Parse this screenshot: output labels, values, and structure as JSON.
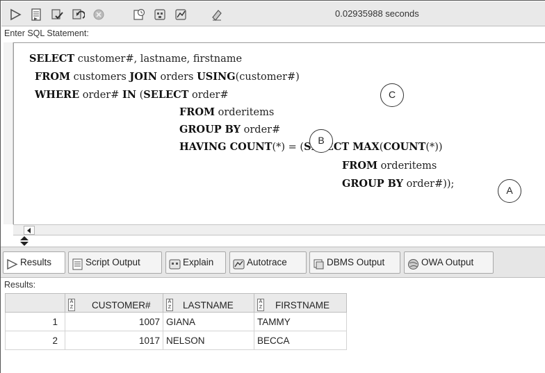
{
  "toolbar": {
    "buttons": [
      {
        "name": "run-statement-icon"
      },
      {
        "name": "run-script-icon"
      },
      {
        "name": "commit-icon"
      },
      {
        "name": "rollback-icon"
      },
      {
        "name": "cancel-icon"
      },
      {
        "name": "sql-history-icon"
      },
      {
        "name": "explain-plan-icon"
      },
      {
        "name": "autotrace-icon"
      },
      {
        "name": "clear-eraser-icon"
      }
    ],
    "elapsed": "0.02935988 seconds"
  },
  "editor": {
    "label": "Enter SQL Statement:",
    "lines": [
      {
        "kw1": "SELECT",
        "t1": " customer#, lastname, firstname"
      },
      {
        "kw1": "FROM",
        "t1": " customers ",
        "kw2": "JOIN",
        "t2": " orders ",
        "kw3": "USING",
        "t3": "(customer#)"
      },
      {
        "kw1": "WHERE",
        "t1": " order# ",
        "kw2": "IN",
        "t2": " (",
        "kw3": "SELECT",
        "t3": " order#"
      },
      {
        "kw1": "FROM",
        "t1": " orderitems"
      },
      {
        "kw1": "GROUP BY",
        "t1": " order#"
      },
      {
        "kw1": "HAVING COUNT",
        "t1": "(*) = (",
        "kw2": "SELECT MAX",
        "t2": "(",
        "kw3": "COUNT",
        "t3": "(*))"
      },
      {
        "kw1": "FROM",
        "t1": " orderitems"
      },
      {
        "kw1": "GROUP BY",
        "t1": " order#));"
      }
    ],
    "markers": {
      "a": "A",
      "b": "B",
      "c": "C"
    }
  },
  "tabs": [
    {
      "label": "Results",
      "icon": "results-play-icon",
      "active": true
    },
    {
      "label": "Script Output",
      "icon": "script-output-icon"
    },
    {
      "label": "Explain",
      "icon": "explain-icon"
    },
    {
      "label": "Autotrace",
      "icon": "autotrace-icon"
    },
    {
      "label": "DBMS Output",
      "icon": "dbms-output-icon"
    },
    {
      "label": "OWA Output",
      "icon": "owa-output-icon"
    }
  ],
  "results": {
    "label": "Results:",
    "columns": [
      "CUSTOMER#",
      "LASTNAME",
      "FIRSTNAME"
    ],
    "rows": [
      {
        "num": "1",
        "customer": "1007",
        "lastname": "GIANA",
        "firstname": "TAMMY"
      },
      {
        "num": "2",
        "customer": "1017",
        "lastname": "NELSON",
        "firstname": "BECCA"
      }
    ]
  }
}
